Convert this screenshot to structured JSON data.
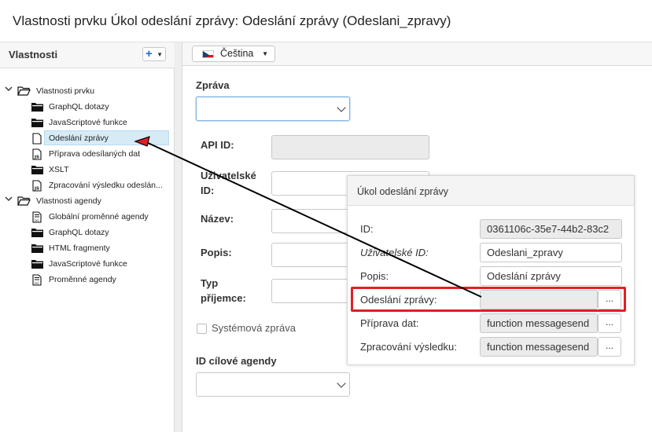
{
  "window": {
    "title": "Vlastnosti prvku Úkol odeslání zprávy: Odeslání zprávy (Odeslani_zpravy)"
  },
  "left_panel": {
    "header": "Vlastnosti",
    "add_button": "+"
  },
  "tree": [
    {
      "label": "Vlastnosti prvku",
      "icon": "folder-open-icon",
      "level": 0,
      "expanded": true
    },
    {
      "label": "GraphQL dotazy",
      "icon": "folder-icon",
      "level": 1
    },
    {
      "label": "JavaScriptové funkce",
      "icon": "folder-icon",
      "level": 1
    },
    {
      "label": "Odeslání zprávy",
      "icon": "file-icon",
      "level": 1,
      "selected": true
    },
    {
      "label": "Příprava odesílaných dat",
      "icon": "js-file-icon",
      "level": 1
    },
    {
      "label": "XSLT",
      "icon": "folder-icon",
      "level": 1
    },
    {
      "label": "Zpracování výsledku odeslán...",
      "icon": "js-file-icon",
      "level": 1
    },
    {
      "label": "Vlastnosti agendy",
      "icon": "folder-open-icon",
      "level": 0,
      "expanded": true
    },
    {
      "label": "Globální proměnné agendy",
      "icon": "variables-icon",
      "level": 1
    },
    {
      "label": "GraphQL dotazy",
      "icon": "folder-icon",
      "level": 1
    },
    {
      "label": "HTML fragmenty",
      "icon": "folder-icon",
      "level": 1
    },
    {
      "label": "JavaScriptové funkce",
      "icon": "folder-icon",
      "level": 1
    },
    {
      "label": "Proměnné agendy",
      "icon": "variables-icon",
      "level": 1
    }
  ],
  "language": {
    "label": "Čeština"
  },
  "form": {
    "message_label": "Zpráva",
    "api_id_label": "API ID:",
    "user_id_label_line1": "Uživatelské",
    "user_id_label_line2": "ID:",
    "name_label": "Název:",
    "description_label": "Popis:",
    "recipient_label_line1": "Typ",
    "recipient_label_line2": "příjemce:",
    "system_message_label": "Systémová zpráva",
    "target_agenda_label": "ID cílové agendy"
  },
  "popup": {
    "title": "Úkol odeslání zprávy",
    "rows": [
      {
        "label": "ID:",
        "value": "0361106c-35e7-44b2-83c2",
        "readonly": true
      },
      {
        "label": "Uživatelské ID:",
        "value": "Odeslani_zpravy",
        "italic": true
      },
      {
        "label": "Popis:",
        "value": "Odeslání zprávy"
      },
      {
        "label": "Odeslání zprávy:",
        "value": "",
        "readonly": true,
        "has_button": true,
        "highlighted": true
      },
      {
        "label": "Příprava dat:",
        "value": "function messagesend",
        "readonly": true,
        "has_button": true
      },
      {
        "label": "Zpracování výsledku:",
        "value": "function messagesend",
        "readonly": true,
        "has_button": true
      }
    ],
    "button_label": "..."
  },
  "colors": {
    "highlight": "#e31e24",
    "selection": "#d7ebf7",
    "accent": "#1e6fd0"
  }
}
